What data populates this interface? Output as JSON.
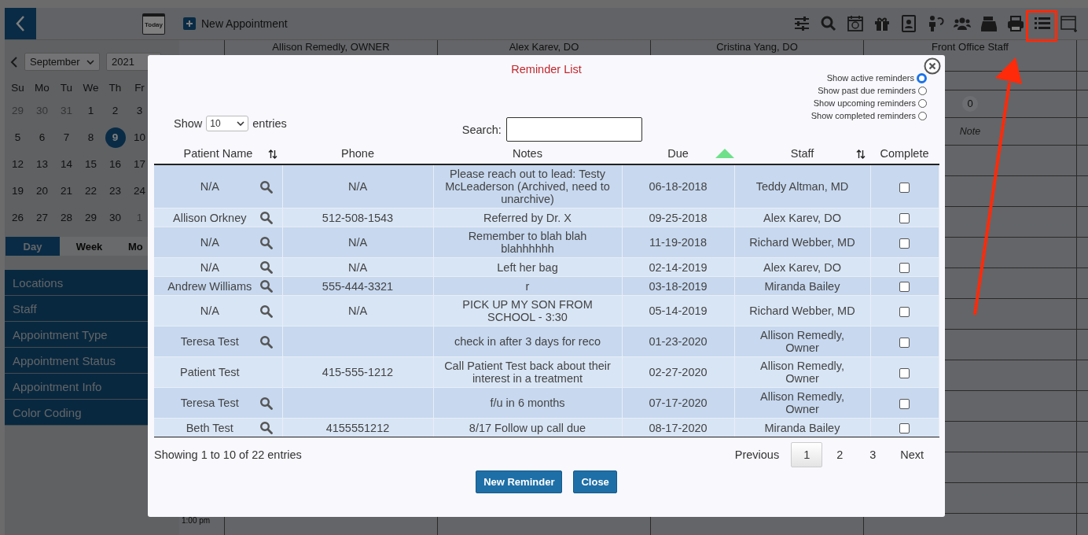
{
  "toolbar": {
    "today_label": "Today",
    "new_appointment": "New Appointment"
  },
  "mini_calendar": {
    "month": "September",
    "year": "2021",
    "weekdays": [
      "Su",
      "Mo",
      "Tu",
      "We",
      "Th",
      "Fr"
    ],
    "weeks": [
      [
        {
          "day": "29",
          "muted": true,
          "selected": false
        },
        {
          "day": "30",
          "muted": true,
          "selected": false
        },
        {
          "day": "31",
          "muted": true,
          "selected": false
        },
        {
          "day": "1",
          "muted": false,
          "selected": false
        },
        {
          "day": "2",
          "muted": false,
          "selected": false
        },
        {
          "day": "3",
          "muted": false,
          "selected": false
        }
      ],
      [
        {
          "day": "5",
          "muted": false,
          "selected": false
        },
        {
          "day": "6",
          "muted": false,
          "selected": false
        },
        {
          "day": "7",
          "muted": false,
          "selected": false
        },
        {
          "day": "8",
          "muted": false,
          "selected": false
        },
        {
          "day": "9",
          "muted": false,
          "selected": true
        },
        {
          "day": "10",
          "muted": false,
          "selected": false
        }
      ],
      [
        {
          "day": "12",
          "muted": false,
          "selected": false
        },
        {
          "day": "13",
          "muted": false,
          "selected": false
        },
        {
          "day": "14",
          "muted": false,
          "selected": false
        },
        {
          "day": "15",
          "muted": false,
          "selected": false
        },
        {
          "day": "16",
          "muted": false,
          "selected": false
        },
        {
          "day": "17",
          "muted": false,
          "selected": false
        }
      ],
      [
        {
          "day": "19",
          "muted": false,
          "selected": false
        },
        {
          "day": "20",
          "muted": false,
          "selected": false
        },
        {
          "day": "21",
          "muted": false,
          "selected": false
        },
        {
          "day": "22",
          "muted": false,
          "selected": false
        },
        {
          "day": "23",
          "muted": false,
          "selected": false
        },
        {
          "day": "24",
          "muted": false,
          "selected": false
        }
      ],
      [
        {
          "day": "26",
          "muted": false,
          "selected": false
        },
        {
          "day": "27",
          "muted": false,
          "selected": false
        },
        {
          "day": "28",
          "muted": false,
          "selected": false
        },
        {
          "day": "29",
          "muted": false,
          "selected": false
        },
        {
          "day": "30",
          "muted": false,
          "selected": false
        },
        {
          "day": "1",
          "muted": true,
          "selected": false
        }
      ]
    ]
  },
  "view_tabs": [
    {
      "label": "Day",
      "selected": true
    },
    {
      "label": "Week",
      "selected": false
    },
    {
      "label": "Mo",
      "selected": false
    }
  ],
  "sidebar_menu": [
    "Locations",
    "Staff",
    "Appointment Type",
    "Appointment Status",
    "Appointment Info",
    "Color Coding"
  ],
  "schedule": {
    "columns": [
      "Allison Remedly, OWNER",
      "Alex Karev, DO",
      "Cristina Yang, DO",
      "Front Office Staff"
    ],
    "count_badge": "0",
    "note": "Note",
    "time_label": "1:00 pm"
  },
  "modal": {
    "title": "Reminder List",
    "filters": [
      {
        "label": "Show active reminders",
        "selected": true
      },
      {
        "label": "Show past due reminders",
        "selected": false
      },
      {
        "label": "Show upcoming reminders",
        "selected": false
      },
      {
        "label": "Show completed reminders",
        "selected": false
      }
    ],
    "show_entries": {
      "before": "Show",
      "value": "10",
      "after": "entries"
    },
    "search": {
      "label": "Search:"
    },
    "columns": [
      {
        "label": "Patient Name",
        "sortable": true,
        "sorted_ascending": false
      },
      {
        "label": "Phone",
        "sortable": false,
        "sorted_ascending": false
      },
      {
        "label": "Notes",
        "sortable": false,
        "sorted_ascending": false
      },
      {
        "label": "Due",
        "sortable": true,
        "sorted_ascending": true
      },
      {
        "label": "Staff",
        "sortable": true,
        "sorted_ascending": false
      },
      {
        "label": "Complete",
        "sortable": false,
        "sorted_ascending": false
      }
    ],
    "rows": [
      {
        "patient": "N/A",
        "lookup": true,
        "phone": "N/A",
        "notes": "Please reach out to lead: Testy McLeaderson (Archived, need to unarchive)",
        "due": "06-18-2018",
        "staff": "Teddy Altman, MD",
        "complete": false
      },
      {
        "patient": "Allison Orkney",
        "lookup": true,
        "phone": "512-508-1543",
        "notes": "Referred by Dr. X",
        "due": "09-25-2018",
        "staff": "Alex Karev, DO",
        "complete": false
      },
      {
        "patient": "N/A",
        "lookup": true,
        "phone": "N/A",
        "notes": "Remember to blah blah blahhhhhh",
        "due": "11-19-2018",
        "staff": "Richard Webber, MD",
        "complete": false
      },
      {
        "patient": "N/A",
        "lookup": true,
        "phone": "N/A",
        "notes": "Left her bag",
        "due": "02-14-2019",
        "staff": "Alex Karev, DO",
        "complete": false
      },
      {
        "patient": "Andrew Williams",
        "lookup": true,
        "phone": "555-444-3321",
        "notes": "r",
        "due": "03-18-2019",
        "staff": "Miranda Bailey",
        "complete": false
      },
      {
        "patient": "N/A",
        "lookup": true,
        "phone": "N/A",
        "notes": "PICK UP MY SON FROM SCHOOL - 3:30",
        "due": "05-14-2019",
        "staff": "Richard Webber, MD",
        "complete": false
      },
      {
        "patient": "Teresa Test",
        "lookup": true,
        "phone": "",
        "notes": "check in after 3 days for reco",
        "due": "01-23-2020",
        "staff": "Allison Remedly, Owner",
        "complete": false
      },
      {
        "patient": "Patient Test",
        "lookup": false,
        "phone": "415-555-1212",
        "notes": "Call Patient Test back about their interest in a treatment",
        "due": "02-27-2020",
        "staff": "Allison Remedly, Owner",
        "complete": false
      },
      {
        "patient": "Teresa Test",
        "lookup": true,
        "phone": "",
        "notes": "f/u in 6 months",
        "due": "07-17-2020",
        "staff": "Allison Remedly, Owner",
        "complete": false
      },
      {
        "patient": "Beth Test",
        "lookup": true,
        "phone": "4155551212",
        "notes": "8/17 Follow up call due",
        "due": "08-17-2020",
        "staff": "Miranda Bailey",
        "complete": false
      }
    ],
    "info": "Showing 1 to 10 of 22 entries",
    "pagination": {
      "previous": "Previous",
      "pages": [
        {
          "label": "1",
          "selected": true
        },
        {
          "label": "2",
          "selected": false
        },
        {
          "label": "3",
          "selected": false
        }
      ],
      "next": "Next"
    },
    "buttons": [
      "New Reminder",
      "Close"
    ]
  }
}
